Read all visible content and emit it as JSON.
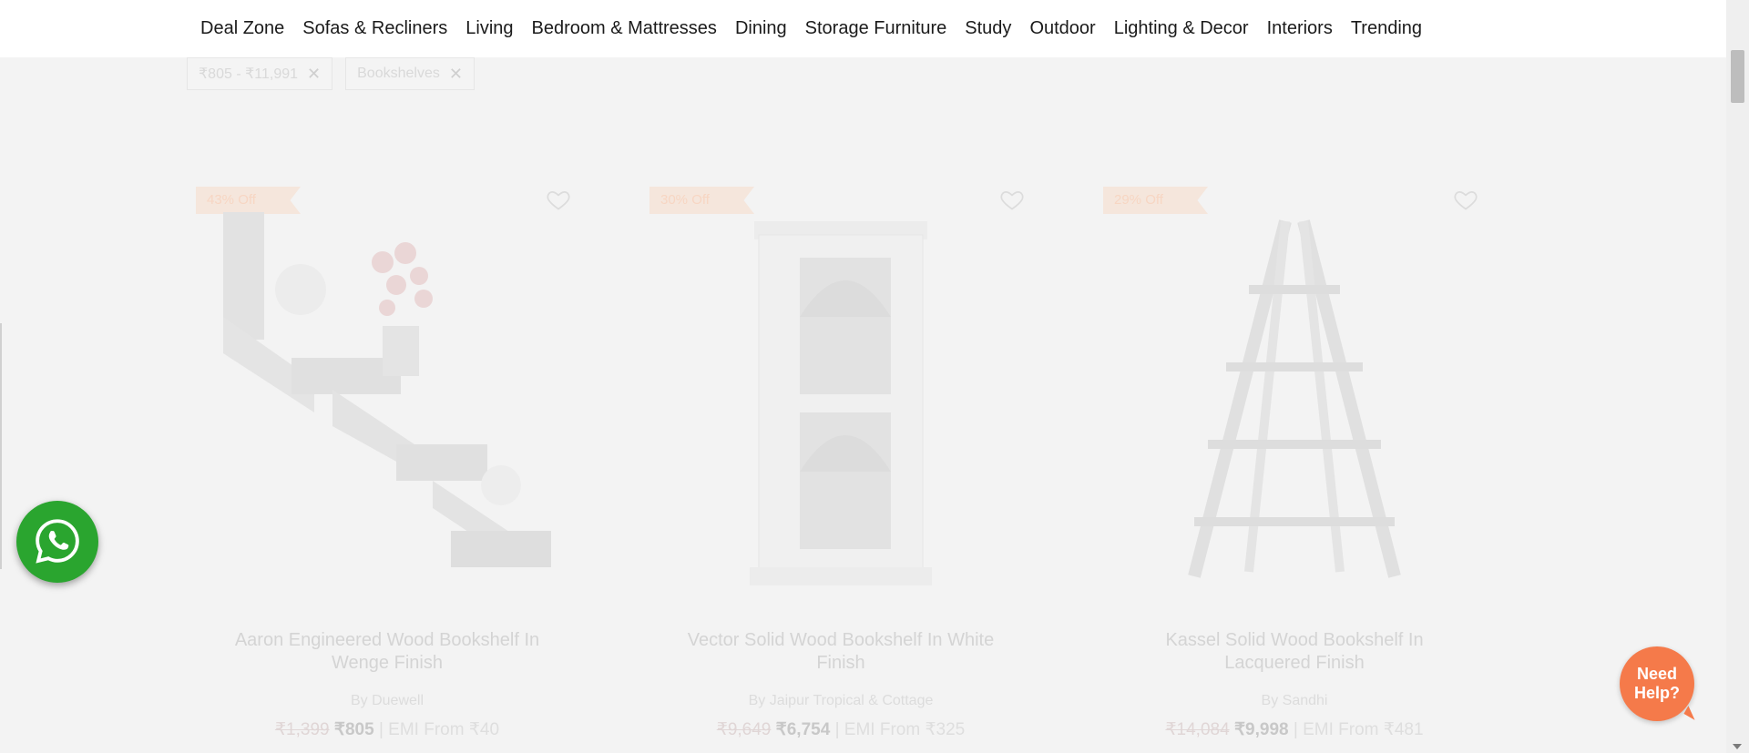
{
  "nav": {
    "items": [
      "Deal Zone",
      "Sofas & Recliners",
      "Living",
      "Bedroom & Mattresses",
      "Dining",
      "Storage Furniture",
      "Study",
      "Outdoor",
      "Lighting & Decor",
      "Interiors",
      "Trending"
    ]
  },
  "filters": {
    "chips": [
      {
        "label": "₹805 - ₹11,991"
      },
      {
        "label": "Bookshelves"
      }
    ]
  },
  "products": [
    {
      "badge": "43% Off",
      "title": "Aaron Engineered Wood Bookshelf In Wenge Finish",
      "brand": "By Duewell",
      "mrp": "₹1,399",
      "price": "₹805",
      "emi": "| EMI From ₹40"
    },
    {
      "badge": "30% Off",
      "title": "Vector Solid Wood Bookshelf In White Finish",
      "brand": "By Jaipur Tropical & Cottage",
      "mrp": "₹9,649",
      "price": "₹6,754",
      "emi": "| EMI From ₹325"
    },
    {
      "badge": "29% Off",
      "title": "Kassel Solid Wood Bookshelf In Lacquered Finish",
      "brand": "By Sandhi",
      "mrp": "₹14,084",
      "price": "₹9,998",
      "emi": "| EMI From ₹481"
    }
  ],
  "help": {
    "label": "Need Help?"
  },
  "colors": {
    "whatsapp": "#2aa52f",
    "help": "#f57a4a"
  },
  "icons": {
    "whatsapp": "whatsapp-icon",
    "heart": "heart-icon",
    "close": "close-icon"
  }
}
